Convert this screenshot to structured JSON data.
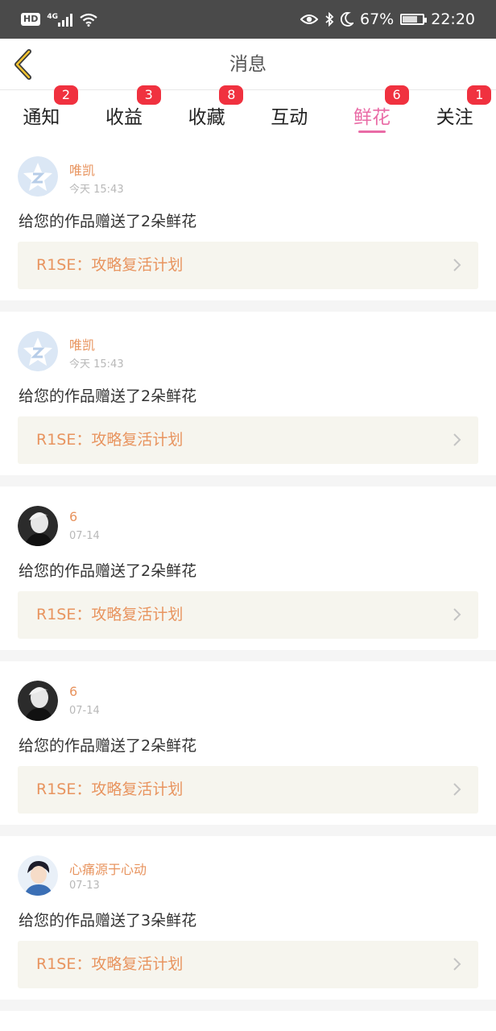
{
  "status_bar": {
    "hd": "HD",
    "network": "4G",
    "battery_text": "67%",
    "battery_level": 0.67,
    "time": "22:20"
  },
  "header": {
    "title": "消息"
  },
  "tabs": [
    {
      "label": "通知",
      "badge": "2"
    },
    {
      "label": "收益",
      "badge": "3"
    },
    {
      "label": "收藏",
      "badge": "8"
    },
    {
      "label": "互动",
      "badge": ""
    },
    {
      "label": "鲜花",
      "badge": "6",
      "active": true
    },
    {
      "label": "关注",
      "badge": "1"
    }
  ],
  "items": [
    {
      "name": "唯凯",
      "time": "今天 15:43",
      "message": "给您的作品赠送了2朵鲜花",
      "work": "R1SE：攻略复活计划",
      "avatar": "default-star-avatar"
    },
    {
      "name": "唯凯",
      "time": "今天 15:43",
      "message": "给您的作品赠送了2朵鲜花",
      "work": "R1SE：攻略复活计划",
      "avatar": "default-star-avatar"
    },
    {
      "name": "6",
      "time": "07-14",
      "message": "给您的作品赠送了2朵鲜花",
      "work": "R1SE：攻略复活计划",
      "avatar": "photo-avatar-dark"
    },
    {
      "name": "6",
      "time": "07-14",
      "message": "给您的作品赠送了2朵鲜花",
      "work": "R1SE：攻略复活计划",
      "avatar": "photo-avatar-dark"
    },
    {
      "name": "心痛源于心动",
      "time": "07-13",
      "message": "给您的作品赠送了3朵鲜花",
      "work": "R1SE：攻略复活计划",
      "avatar": "photo-avatar-light"
    }
  ],
  "colors": {
    "accent_pink": "#e96ba6",
    "accent_orange": "#e8945f",
    "badge_red": "#f0313f",
    "status_bar": "#4a4a4a"
  }
}
